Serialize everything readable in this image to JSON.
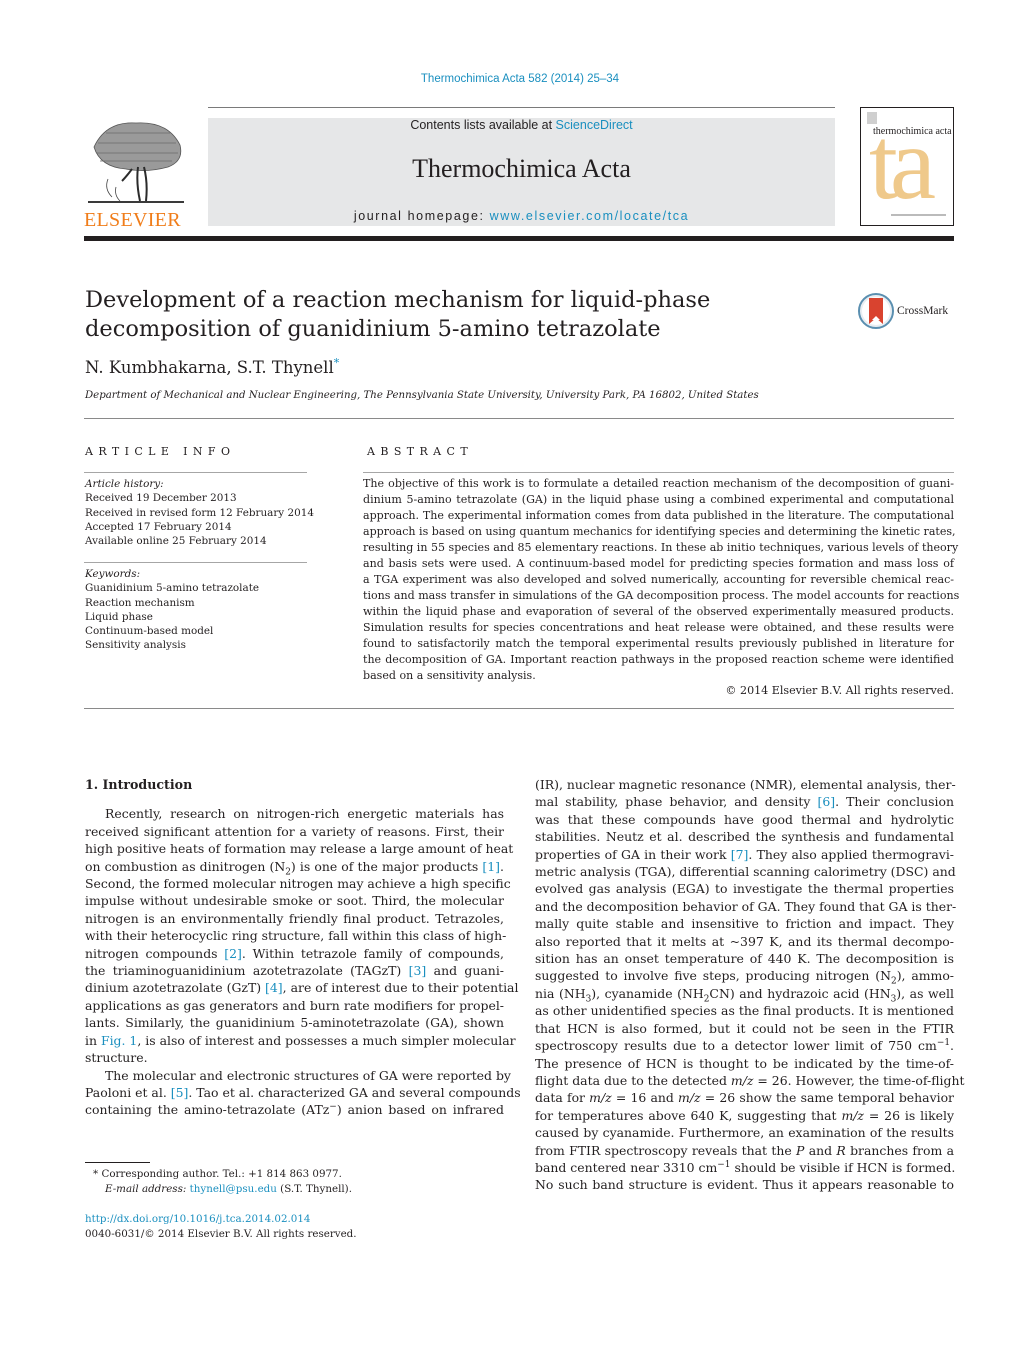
{
  "header": {
    "citation": "Thermochimica Acta 582 (2014) 25–34",
    "contents_prefix": "Contents lists available at ",
    "contents_link": "ScienceDirect",
    "journal_title": "Thermochimica Acta",
    "homepage_prefix": "journal homepage: ",
    "homepage_link": "www.elsevier.com/locate/tca",
    "publisher_logo_text": "ELSEVIER",
    "cover_title": "thermochimica acta",
    "cover_monogram": "ta"
  },
  "article": {
    "title_line1": "Development of a reaction mechanism for liquid-phase",
    "title_line2": "decomposition of guanidinium 5-amino tetrazolate",
    "crossmark_label": "CrossMark",
    "authors": "N. Kumbhakarna, S.T. Thynell",
    "corresponding_mark": "*",
    "affiliation": "Department of Mechanical and Nuclear Engineering, The Pennsylvania State University, University Park, PA 16802, United States"
  },
  "article_info": {
    "heading": "ARTICLE INFO",
    "history_label": "Article history:",
    "history": [
      "Received 19 December 2013",
      "Received in revised form 12 February 2014",
      "Accepted 17 February 2014",
      "Available online 25 February 2014"
    ],
    "keywords_label": "Keywords:",
    "keywords": [
      "Guanidinium 5-amino tetrazolate",
      "Reaction mechanism",
      "Liquid phase",
      "Continuum-based model",
      "Sensitivity analysis"
    ]
  },
  "abstract": {
    "heading": "ABSTRACT",
    "lines": [
      "The objective of this work is to formulate a detailed reaction mechanism of the decomposition of guani-",
      "dinium 5-amino tetrazolate (GA) in the liquid phase using a combined experimental and computational",
      "approach. The experimental information comes from data published in the literature. The computational",
      "approach is based on using quantum mechanics for identifying species and determining the kinetic rates,",
      "resulting in 55 species and 85 elementary reactions. In these ab initio techniques, various levels of theory",
      "and basis sets were used. A continuum-based model for predicting species formation and mass loss of",
      "a TGA experiment was also developed and solved numerically, accounting for reversible chemical reac-",
      "tions and mass transfer in simulations of the GA decomposition process. The model accounts for reactions",
      "within the liquid phase and evaporation of several of the observed experimentally measured products.",
      "Simulation results for species concentrations and heat release were obtained, and these results were",
      "found to satisfactorily match the temporal experimental results previously published in literature for",
      "the decomposition of GA. Important reaction pathways in the proposed reaction scheme were identified",
      "based on a sensitivity analysis."
    ],
    "copyright": "© 2014 Elsevier B.V. All rights reserved."
  },
  "body": {
    "section_title": "1.  Introduction",
    "left_lines": [
      {
        "parts": [
          {
            "t": "Recently, research on nitrogen-rich energetic materials has"
          }
        ],
        "indent": true
      },
      {
        "parts": [
          {
            "t": "received significant attention for a variety of reasons. First, their"
          }
        ]
      },
      {
        "parts": [
          {
            "t": "high positive heats of formation may release a large amount of heat"
          }
        ]
      },
      {
        "parts": [
          {
            "t": "on combustion as dinitrogen (N"
          },
          {
            "t": "2",
            "sub": true
          },
          {
            "t": ") is one of the major products "
          },
          {
            "t": "[1]",
            "link": true
          },
          {
            "t": "."
          }
        ]
      },
      {
        "parts": [
          {
            "t": "Second, the formed molecular nitrogen may achieve a high specific"
          }
        ]
      },
      {
        "parts": [
          {
            "t": "impulse without undesirable smoke or soot. Third, the molecular"
          }
        ]
      },
      {
        "parts": [
          {
            "t": "nitrogen is an environmentally friendly final product. Tetrazoles,"
          }
        ]
      },
      {
        "parts": [
          {
            "t": "with their heterocyclic ring structure, fall within this class of high-"
          }
        ]
      },
      {
        "parts": [
          {
            "t": "nitrogen compounds "
          },
          {
            "t": "[2]",
            "link": true
          },
          {
            "t": ". Within tetrazole family of compounds,"
          }
        ]
      },
      {
        "parts": [
          {
            "t": "the triaminoguanidinium azotetrazolate (TAGzT) "
          },
          {
            "t": "[3]",
            "link": true
          },
          {
            "t": " and guani-"
          }
        ]
      },
      {
        "parts": [
          {
            "t": "dinium azotetrazolate (GzT) "
          },
          {
            "t": "[4]",
            "link": true
          },
          {
            "t": ", are of interest due to their potential"
          }
        ]
      },
      {
        "parts": [
          {
            "t": "applications as gas generators and burn rate modifiers for propel-"
          }
        ]
      },
      {
        "parts": [
          {
            "t": "lants. Similarly, the guanidinium 5-aminotetrazolate (GA), shown"
          }
        ]
      },
      {
        "parts": [
          {
            "t": "in "
          },
          {
            "t": "Fig. 1",
            "link": true
          },
          {
            "t": ", is also of interest and possesses a much simpler molecular"
          }
        ]
      },
      {
        "parts": [
          {
            "t": "structure."
          }
        ],
        "last": true
      },
      {
        "parts": [
          {
            "t": "The molecular and electronic structures of GA were reported by"
          }
        ],
        "indent": true
      },
      {
        "parts": [
          {
            "t": "Paoloni et al. "
          },
          {
            "t": "[5]",
            "link": true
          },
          {
            "t": ". Tao et al. characterized GA and several compounds"
          }
        ]
      },
      {
        "parts": [
          {
            "t": "containing the amino-tetrazolate (ATz"
          },
          {
            "t": "−",
            "sup": true
          },
          {
            "t": ") anion based on infrared"
          }
        ]
      }
    ],
    "right_lines": [
      {
        "parts": [
          {
            "t": "(IR), nuclear magnetic resonance (NMR), elemental analysis, ther-"
          }
        ]
      },
      {
        "parts": [
          {
            "t": "mal stability, phase behavior, and density "
          },
          {
            "t": "[6]",
            "link": true
          },
          {
            "t": ". Their conclusion"
          }
        ]
      },
      {
        "parts": [
          {
            "t": "was that these compounds have good thermal and hydrolytic"
          }
        ]
      },
      {
        "parts": [
          {
            "t": "stabilities. Neutz et al. described the synthesis and fundamental"
          }
        ]
      },
      {
        "parts": [
          {
            "t": "properties of GA in their work "
          },
          {
            "t": "[7]",
            "link": true
          },
          {
            "t": ". They also applied thermogravi-"
          }
        ]
      },
      {
        "parts": [
          {
            "t": "metric analysis (TGA), differential scanning calorimetry (DSC) and"
          }
        ]
      },
      {
        "parts": [
          {
            "t": "evolved gas analysis (EGA) to investigate the thermal properties"
          }
        ]
      },
      {
        "parts": [
          {
            "t": "and the decomposition behavior of GA. They found that GA is ther-"
          }
        ]
      },
      {
        "parts": [
          {
            "t": "mally quite stable and insensitive to friction and impact. They"
          }
        ]
      },
      {
        "parts": [
          {
            "t": "also reported that it melts at ~397 K, and its thermal decompo-"
          }
        ]
      },
      {
        "parts": [
          {
            "t": "sition has an onset temperature of 440 K. The decomposition is"
          }
        ]
      },
      {
        "parts": [
          {
            "t": "suggested to involve five steps, producing nitrogen (N"
          },
          {
            "t": "2",
            "sub": true
          },
          {
            "t": "), ammo-"
          }
        ]
      },
      {
        "parts": [
          {
            "t": "nia (NH"
          },
          {
            "t": "3",
            "sub": true
          },
          {
            "t": "), cyanamide (NH"
          },
          {
            "t": "2",
            "sub": true
          },
          {
            "t": "CN) and hydrazoic acid (HN"
          },
          {
            "t": "3",
            "sub": true
          },
          {
            "t": "), as well"
          }
        ]
      },
      {
        "parts": [
          {
            "t": "as other unidentified species as the final products. It is mentioned"
          }
        ]
      },
      {
        "parts": [
          {
            "t": "that HCN is also formed, but it could not be seen in the FTIR"
          }
        ]
      },
      {
        "parts": [
          {
            "t": "spectroscopy results due to a detector lower limit of 750 cm"
          },
          {
            "t": "−1",
            "sup": true
          },
          {
            "t": "."
          }
        ]
      },
      {
        "parts": [
          {
            "t": "The presence of HCN is thought to be indicated by the time-of-"
          }
        ]
      },
      {
        "parts": [
          {
            "t": "flight data due to the detected "
          },
          {
            "t": "m/z",
            "it": true
          },
          {
            "t": " = 26. However, the time-of-flight"
          }
        ]
      },
      {
        "parts": [
          {
            "t": "data for "
          },
          {
            "t": "m/z",
            "it": true
          },
          {
            "t": " = 16 and "
          },
          {
            "t": "m/z",
            "it": true
          },
          {
            "t": " = 26 show the same temporal behavior"
          }
        ]
      },
      {
        "parts": [
          {
            "t": "for temperatures above 640 K, suggesting that "
          },
          {
            "t": "m/z",
            "it": true
          },
          {
            "t": " = 26 is likely"
          }
        ]
      },
      {
        "parts": [
          {
            "t": "caused by cyanamide. Furthermore, an examination of the results"
          }
        ]
      },
      {
        "parts": [
          {
            "t": "from FTIR spectroscopy reveals that the "
          },
          {
            "t": "P",
            "it": true
          },
          {
            "t": " and "
          },
          {
            "t": "R",
            "it": true
          },
          {
            "t": " branches from a"
          }
        ]
      },
      {
        "parts": [
          {
            "t": "band centered near 3310 cm"
          },
          {
            "t": "−1",
            "sup": true
          },
          {
            "t": " should be visible if HCN is formed."
          }
        ]
      },
      {
        "parts": [
          {
            "t": "No such band structure is evident. Thus it appears reasonable to"
          }
        ]
      }
    ]
  },
  "footnotes": {
    "marker": "*",
    "corresponding": "Corresponding author. Tel.: +1 814 863 0977.",
    "email_label": "E-mail address:",
    "email": "thynell@psu.edu",
    "email_suffix": " (S.T. Thynell).",
    "doi": "http://dx.doi.org/10.1016/j.tca.2014.02.014",
    "issn_line": "0040-6031/© 2014 Elsevier B.V. All rights reserved."
  },
  "colors": {
    "link": "#1a8fbf",
    "elsevier_orange": "#f07d1a",
    "masthead_bg": "#e6e7e8",
    "cover_accent": "#efc98b",
    "crossmark_red": "#d9432f"
  }
}
